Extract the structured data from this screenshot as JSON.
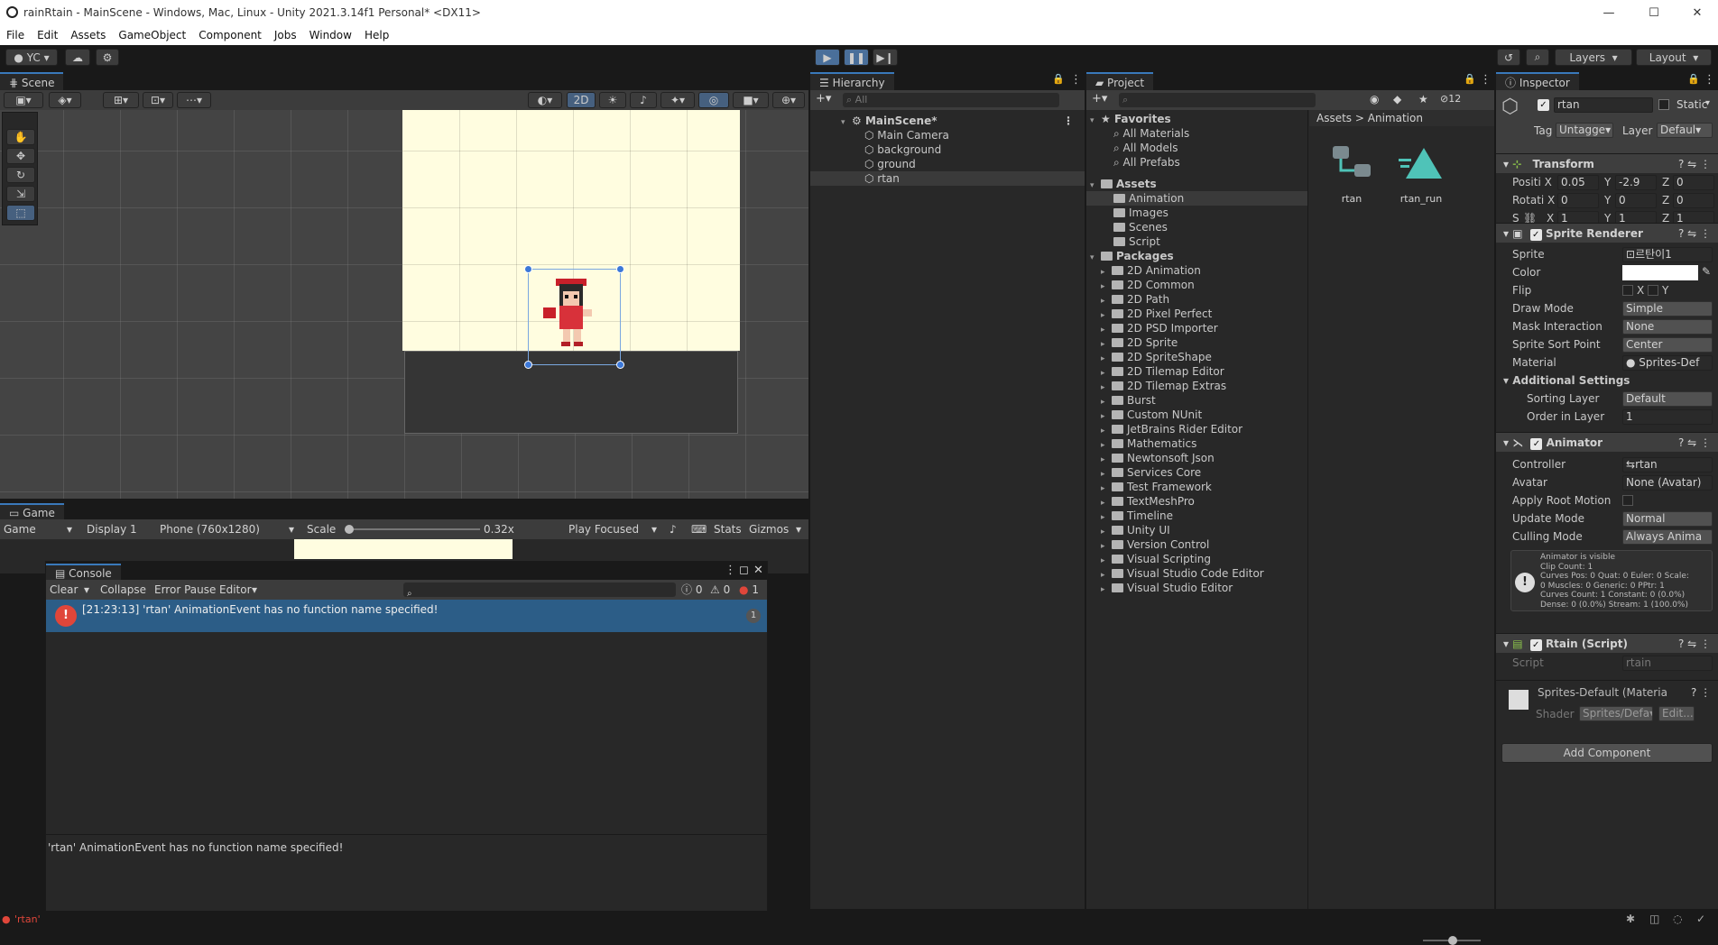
{
  "window": {
    "title": "rainRtain - MainScene - Windows, Mac, Linux - Unity 2021.3.14f1 Personal* <DX11>",
    "minimize": "—",
    "maximize": "☐",
    "close": "✕"
  },
  "menu": [
    "File",
    "Edit",
    "Assets",
    "GameObject",
    "Component",
    "Jobs",
    "Window",
    "Help"
  ],
  "toolbar": {
    "account": "YC",
    "layers": "Layers",
    "layout": "Layout"
  },
  "scene": {
    "tab": "Scene",
    "mode2d": "2D"
  },
  "game": {
    "tab": "Game",
    "view": "Game",
    "display": "Display 1",
    "resolution": "Phone (760x1280)",
    "scale_label": "Scale",
    "scale_value": "0.32x",
    "play_focused": "Play Focused",
    "stats": "Stats",
    "gizmos": "Gizmos"
  },
  "console": {
    "tab": "Console",
    "clear": "Clear",
    "collapse": "Collapse",
    "error_pause": "Error Pause",
    "editor": "Editor",
    "info_count": "0",
    "warn_count": "0",
    "error_count": "1",
    "message": "[21:23:13] 'rtan' AnimationEvent has no function name specified!",
    "message_count": "1",
    "detail": "'rtan' AnimationEvent has no function name specified!"
  },
  "statusbar": {
    "text": "'rtan'"
  },
  "hierarchy": {
    "tab": "Hierarchy",
    "search_placeholder": "All",
    "scene": "MainScene*",
    "items": [
      "Main Camera",
      "background",
      "ground",
      "rtan"
    ]
  },
  "project": {
    "tab": "Project",
    "hidden_count": "12",
    "favorites_label": "Favorites",
    "favorites": [
      "All Materials",
      "All Models",
      "All Prefabs"
    ],
    "assets_label": "Assets",
    "assets": [
      "Animation",
      "Images",
      "Scenes",
      "Script"
    ],
    "packages_label": "Packages",
    "packages": [
      "2D Animation",
      "2D Common",
      "2D Path",
      "2D Pixel Perfect",
      "2D PSD Importer",
      "2D Sprite",
      "2D SpriteShape",
      "2D Tilemap Editor",
      "2D Tilemap Extras",
      "Burst",
      "Custom NUnit",
      "JetBrains Rider Editor",
      "Mathematics",
      "Newtonsoft Json",
      "Services Core",
      "Test Framework",
      "TextMeshPro",
      "Timeline",
      "Unity UI",
      "Version Control",
      "Visual Scripting",
      "Visual Studio Code Editor",
      "Visual Studio Editor"
    ],
    "breadcrumb_root": "Assets",
    "breadcrumb_sep": ">",
    "breadcrumb_current": "Animation",
    "files": [
      "rtan",
      "rtan_run"
    ]
  },
  "inspector": {
    "tab": "Inspector",
    "name": "rtan",
    "static": "Static",
    "tag_label": "Tag",
    "tag": "Untagge▾",
    "layer_label": "Layer",
    "layer": "Defaul▾",
    "transform": {
      "title": "Transform",
      "pos_label": "Positi X",
      "pos": [
        "0.05",
        "-2.9",
        "0"
      ],
      "rot_label": "Rotati X",
      "rot": [
        "0",
        "0",
        "0"
      ],
      "scale_label": "S",
      "scale": [
        "1",
        "1",
        "1"
      ],
      "x": "X",
      "y": "Y",
      "z": "Z"
    },
    "sprite_renderer": {
      "title": "Sprite Renderer",
      "labels": [
        "Sprite",
        "Color",
        "Flip",
        "Draw Mode",
        "Mask Interaction",
        "Sprite Sort Point",
        "Material"
      ],
      "sprite": "르탄이1",
      "flip_x": "X",
      "flip_y": "Y",
      "draw_mode": "Simple",
      "mask": "None",
      "sort_point": "Center",
      "material": "Sprites-Def",
      "additional": "Additional Settings",
      "sorting_layer_label": "Sorting Layer",
      "sorting_layer": "Default",
      "order_label": "Order in Layer",
      "order": "1"
    },
    "animator": {
      "title": "Animator",
      "labels": [
        "Controller",
        "Avatar",
        "Apply Root Motion",
        "Update Mode",
        "Culling Mode"
      ],
      "controller": "rtan",
      "avatar": "None (Avatar)",
      "update_mode": "Normal",
      "culling_mode": "Always Anima",
      "info": [
        "Animator is visible",
        "Clip Count: 1",
        "Curves Pos: 0 Quat: 0 Euler: 0 Scale:",
        "0 Muscles: 0 Generic: 0 PPtr: 1",
        "Curves Count: 1 Constant: 0 (0.0%)",
        "Dense: 0 (0.0%) Stream: 1 (100.0%)"
      ]
    },
    "script": {
      "title": "Rtain (Script)",
      "label": "Script",
      "value": "rtain"
    },
    "material": {
      "title": "Sprites-Default (Materia",
      "shader_label": "Shader",
      "shader": "Sprites/Defa▾",
      "edit": "Edit..."
    },
    "add_component": "Add Component"
  },
  "colors": {
    "accent": "#3a79bb",
    "scene_bg": "#fffde0",
    "error": "#e0463a"
  }
}
